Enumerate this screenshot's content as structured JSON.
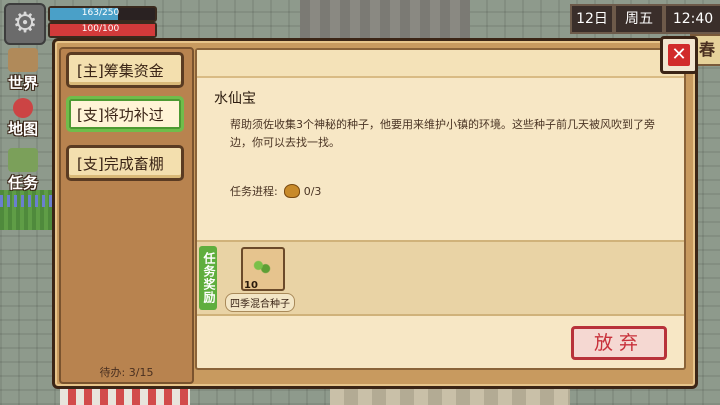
{
  "hud": {
    "hp_text": "163/250",
    "hp_fraction": 0.652,
    "energy_text": "100/100",
    "energy_fraction": 1.0,
    "nav": [
      {
        "label": "世界",
        "icon": "world-icon"
      },
      {
        "label": "地图",
        "icon": "map-pin-icon"
      },
      {
        "label": "任务",
        "icon": "task-icon"
      }
    ],
    "date_day": "12日",
    "date_weekday": "周五",
    "time": "12:40",
    "season": "春"
  },
  "quest_list": {
    "items": [
      {
        "label": "[主]筹集资金",
        "selected": false
      },
      {
        "label": "[支]将功补过",
        "selected": true
      },
      {
        "label": "[支]完成畜棚",
        "selected": false
      }
    ],
    "pending_text": "待办:   3/15"
  },
  "quest_detail": {
    "title": "水仙宝",
    "description": "帮助须佐收集3个神秘的种子，他要用来维护小镇的环境。这些种子前几天被风吹到了旁边，你可以去找一找。",
    "progress_label": "任务进程:",
    "progress_value": "0/3",
    "reward_label": "任务奖励",
    "reward": {
      "quantity": "10",
      "name": "四季混合种子"
    },
    "abandon_label": "放弃"
  },
  "close_label": "✕",
  "colors": {
    "window": "#c89a5f",
    "selected_border": "#6fbd4b",
    "abandon": "#c8303a",
    "reward_tag": "#5fae3e"
  }
}
